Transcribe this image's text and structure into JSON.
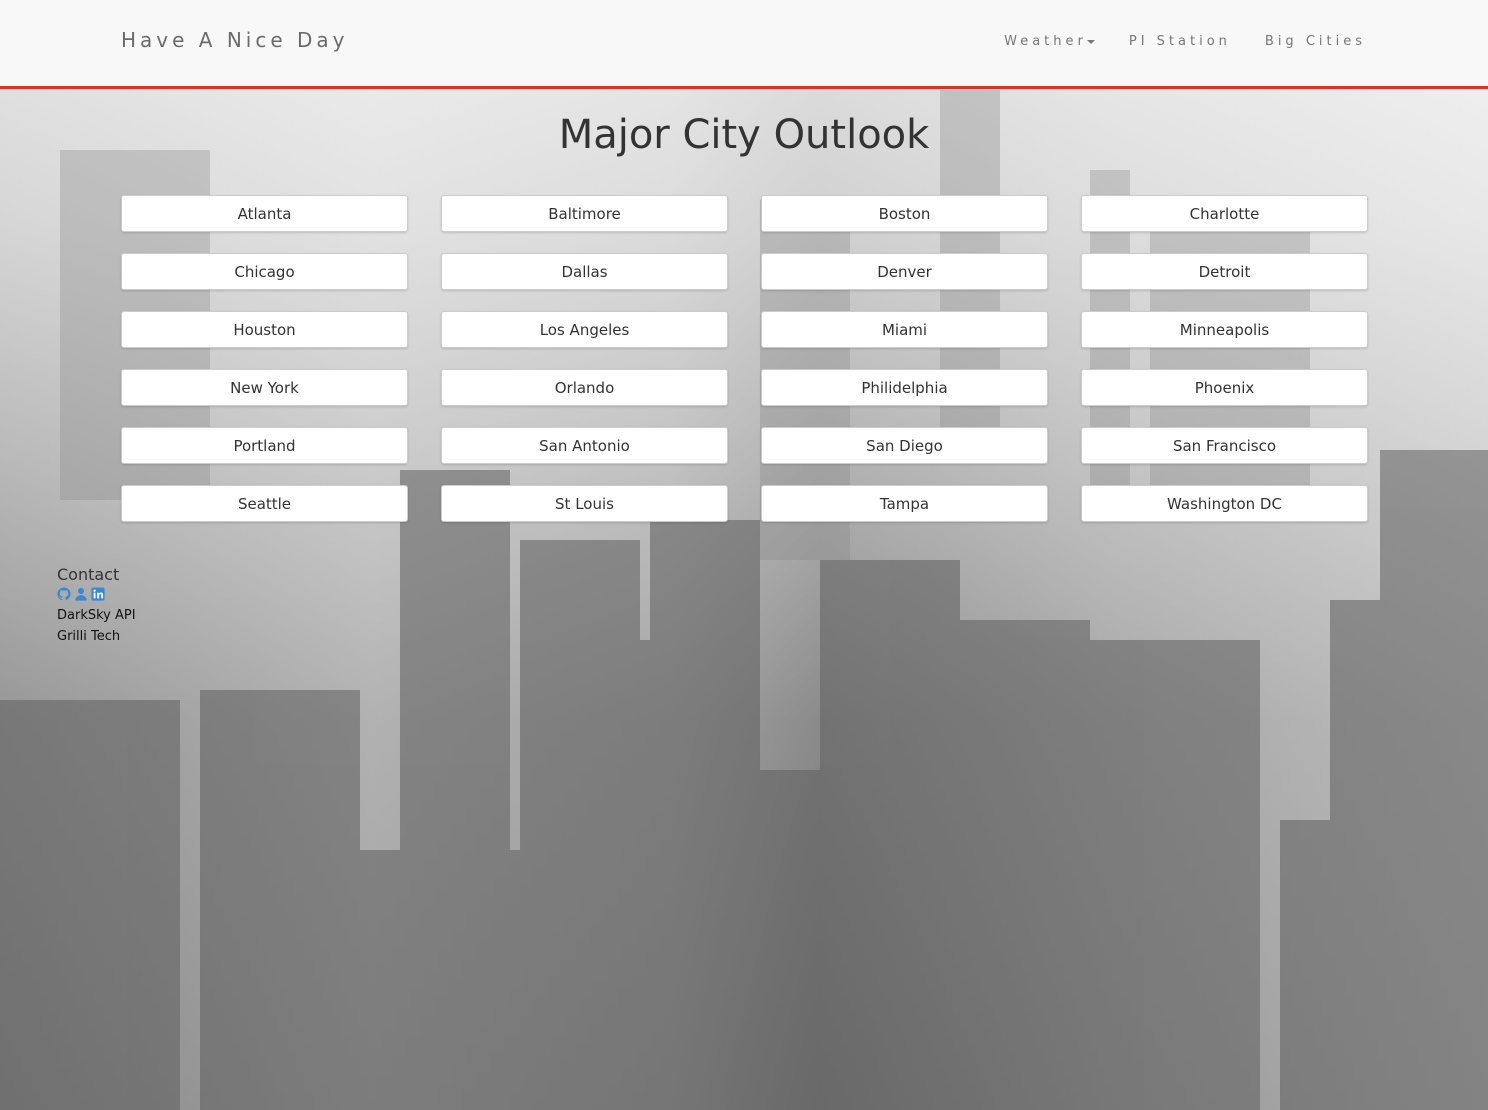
{
  "navbar": {
    "brand": "Have A Nice Day",
    "weather_label": "Weather",
    "pi_station_label": "PI Station",
    "big_cities_label": "Big Cities",
    "accent_color": "#d9342b"
  },
  "main": {
    "title": "Major City Outlook",
    "cities": [
      "Atlanta",
      "Baltimore",
      "Boston",
      "Charlotte",
      "Chicago",
      "Dallas",
      "Denver",
      "Detroit",
      "Houston",
      "Los Angeles",
      "Miami",
      "Minneapolis",
      "New York",
      "Orlando",
      "Philidelphia",
      "Phoenix",
      "Portland",
      "San Antonio",
      "San Diego",
      "San Francisco",
      "Seattle",
      "St Louis",
      "Tampa",
      "Washington DC"
    ]
  },
  "footer": {
    "contact_heading": "Contact",
    "icons": [
      "github-icon",
      "user-icon",
      "linkedin-icon"
    ],
    "icon_color": "#3a87d6",
    "links": [
      "DarkSky API",
      "Grilli Tech"
    ]
  }
}
